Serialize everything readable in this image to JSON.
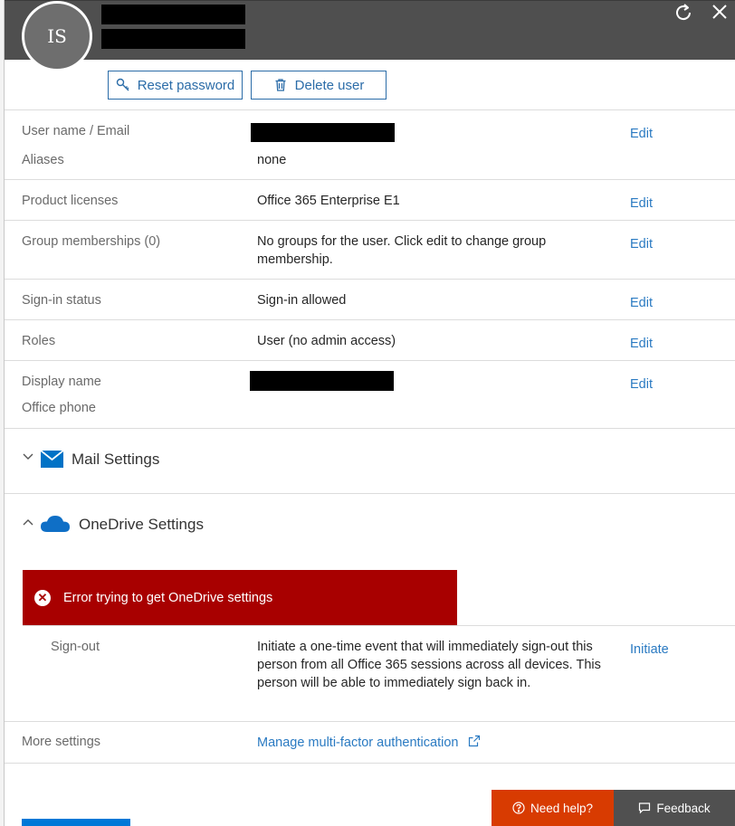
{
  "header": {
    "avatar_initials": "IS"
  },
  "toolbar": {
    "reset_password_label": "Reset password",
    "delete_user_label": "Delete user"
  },
  "fields": {
    "username_label": "User name / Email",
    "aliases_label": "Aliases",
    "aliases_value": "none",
    "licenses_label": "Product licenses",
    "licenses_value": "Office 365 Enterprise E1",
    "groups_label": "Group memberships (0)",
    "groups_value": "No groups for the user. Click edit to change group membership.",
    "signin_label": "Sign-in status",
    "signin_value": "Sign-in allowed",
    "roles_label": "Roles",
    "roles_value": "User (no admin access)",
    "display_name_label": "Display name",
    "office_phone_label": "Office phone",
    "edit_label": "Edit"
  },
  "mail_settings": {
    "title": "Mail Settings"
  },
  "onedrive": {
    "title": "OneDrive Settings",
    "error_text": "Error trying to get OneDrive settings",
    "signout_label": "Sign-out",
    "signout_desc": "Initiate a one-time event that will immediately sign-out this person from all Office 365 sessions across all devices. This person will be able to immediately sign back in.",
    "initiate_label": "Initiate"
  },
  "more_settings": {
    "label": "More settings",
    "mfa_link": "Manage multi-factor authentication"
  },
  "footer": {
    "need_help_label": "Need help?",
    "feedback_label": "Feedback"
  },
  "colors": {
    "header_bg": "#4f4f4f",
    "accent": "#2a7ac2",
    "error_bg": "#a80000",
    "need_help_bg": "#d83b01",
    "feedback_bg": "#505050"
  }
}
